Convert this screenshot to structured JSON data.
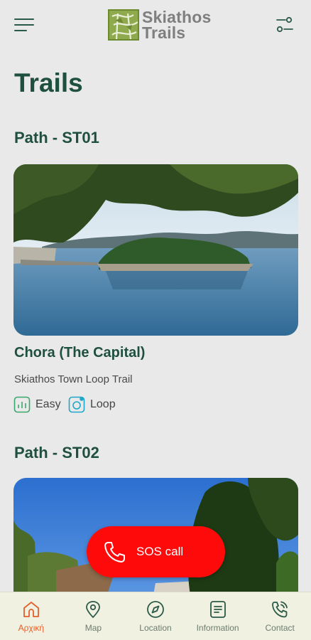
{
  "header": {
    "logo_line1": "Skiathos",
    "logo_line2": "Trails"
  },
  "page": {
    "title": "Trails"
  },
  "sections": [
    {
      "heading": "Path - ST01",
      "card": {
        "title": "Chora (The Capital)",
        "subtitle": "Skiathos Town Loop Trail",
        "difficulty": "Easy",
        "route_type": "Loop"
      }
    },
    {
      "heading": "Path - ST02"
    }
  ],
  "sos": {
    "label": "SOS call"
  },
  "nav": [
    {
      "label": "Αρχική",
      "icon": "home-icon",
      "active": true
    },
    {
      "label": "Map",
      "icon": "map-pin-icon",
      "active": false
    },
    {
      "label": "Location",
      "icon": "compass-icon",
      "active": false
    },
    {
      "label": "Information",
      "icon": "document-icon",
      "active": false
    },
    {
      "label": "Contact",
      "icon": "phone-icon",
      "active": false
    }
  ],
  "colors": {
    "primary_text": "#1f4f3e",
    "accent_active": "#e2602b",
    "sos_red": "#ff0a0a",
    "logo_green": "#8aa34a",
    "tag_green": "#3aa76d",
    "tag_cyan": "#1ea7c8"
  }
}
